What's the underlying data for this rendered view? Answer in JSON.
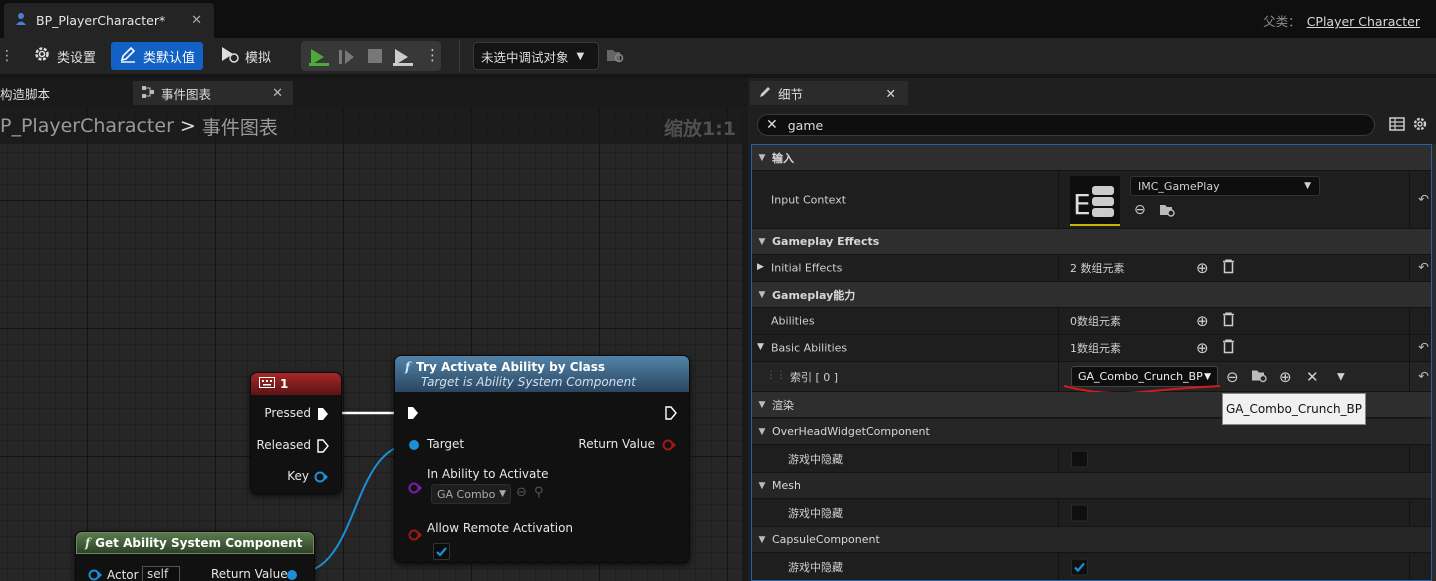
{
  "title_bar": {
    "tab_title": "BP_PlayerCharacter*",
    "parent_label": "父类：",
    "parent_class": "CPlayer Character"
  },
  "toolbar": {
    "class_settings": "类设置",
    "class_defaults": "类默认值",
    "simulate": "模拟",
    "debug_target": "未选中调试对象"
  },
  "left_panel": {
    "tab_construction": "构造脚本",
    "tab_event_graph": "事件图表",
    "breadcrumb_root": "P_PlayerCharacter",
    "breadcrumb_sep": ">",
    "breadcrumb_leaf": "事件图表",
    "zoom": "缩放1:1"
  },
  "nodes": {
    "key_event": {
      "title": "1",
      "pin_pressed": "Pressed",
      "pin_released": "Released",
      "pin_key": "Key"
    },
    "try_activate": {
      "title": "Try Activate Ability by Class",
      "subtitle": "Target is Ability System Component",
      "pin_target": "Target",
      "pin_return": "Return Value",
      "pin_ability": "In Ability to Activate",
      "ability_value": "GA Combo",
      "pin_remote": "Allow Remote Activation"
    },
    "get_asc": {
      "title": "Get Ability System Component",
      "pin_actor": "Actor",
      "actor_value": "self",
      "pin_return": "Return Value"
    }
  },
  "details": {
    "tab_title": "细节",
    "search_value": "game",
    "categories": {
      "input": "输入",
      "gameplay_effects": "Gameplay Effects",
      "gameplay_abilities": "Gameplay能力",
      "rendering": "渲染",
      "overhead": "OverHeadWidgetComponent",
      "mesh": "Mesh",
      "capsule": "CapsuleComponent"
    },
    "props": {
      "input_context_label": "Input Context",
      "input_context_value": "IMC_GamePlay",
      "initial_effects_label": "Initial Effects",
      "initial_effects_value": "2 数组元素",
      "abilities_label": "Abilities",
      "abilities_value": "0数组元素",
      "basic_abilities_label": "Basic Abilities",
      "basic_abilities_value": "1数组元素",
      "index_label": "索引 [ 0 ]",
      "index_value": "GA_Combo_Crunch_BP",
      "hide_in_game": "游戏中隐藏"
    },
    "checkboxes": {
      "overhead_hidden": false,
      "mesh_hidden": false,
      "capsule_hidden": true
    },
    "tooltip": "GA_Combo_Crunch_BP"
  }
}
